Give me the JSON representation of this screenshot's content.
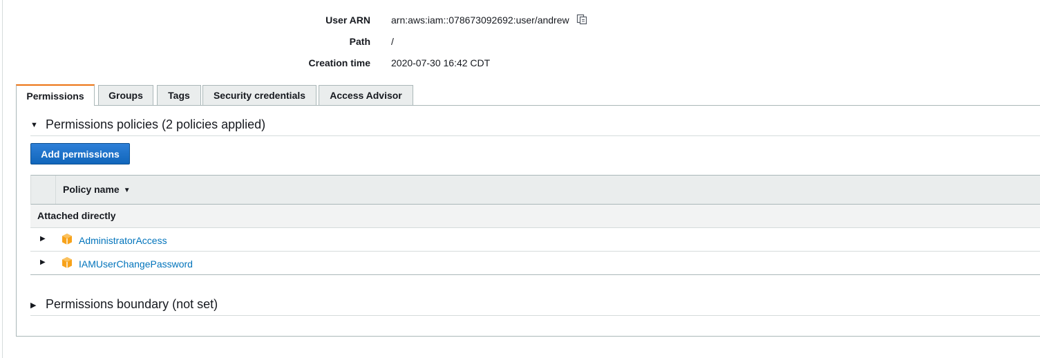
{
  "summary": {
    "user_arn_label": "User ARN",
    "user_arn_value": "arn:aws:iam::078673092692:user/andrew",
    "path_label": "Path",
    "path_value": "/",
    "creation_time_label": "Creation time",
    "creation_time_value": "2020-07-30 16:42 CDT",
    "copy_icon": "copy-icon"
  },
  "tabs": [
    {
      "label": "Permissions",
      "active": true
    },
    {
      "label": "Groups",
      "active": false
    },
    {
      "label": "Tags",
      "active": false
    },
    {
      "label": "Security credentials",
      "active": false
    },
    {
      "label": "Access Advisor",
      "active": false
    }
  ],
  "permissions_policies": {
    "heading": "Permissions policies (2 policies applied)",
    "expanded": true,
    "add_button_label": "Add permissions",
    "table": {
      "column_header": "Policy name",
      "group_label": "Attached directly",
      "rows": [
        {
          "name": "AdministratorAccess",
          "icon": "aws-managed-policy-icon"
        },
        {
          "name": "IAMUserChangePassword",
          "icon": "aws-managed-policy-icon"
        }
      ]
    }
  },
  "permissions_boundary": {
    "heading": "Permissions boundary (not set)",
    "expanded": false
  },
  "colors": {
    "accent_tab": "#ec7211",
    "primary_button": "#1166bb",
    "link": "#0073bb",
    "policy_icon": "#f7a21a"
  }
}
